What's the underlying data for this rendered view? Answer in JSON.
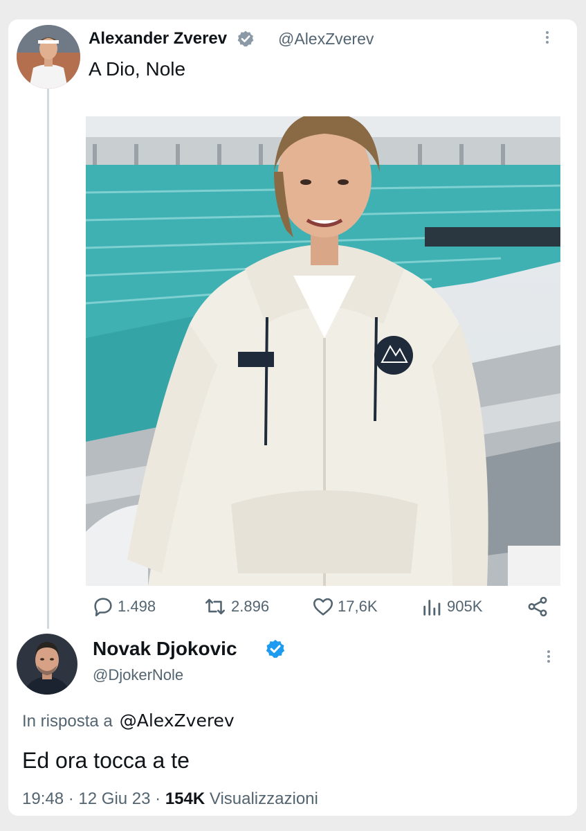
{
  "original_tweet": {
    "author_name": "Alexander Zverev",
    "author_handle": "@AlexZverev",
    "text": "A Dio, Nole",
    "stats": {
      "replies": "1.498",
      "retweets": "2.896",
      "likes": "17,6K",
      "views": "905K"
    }
  },
  "reply_tweet": {
    "author_name": "Novak Djokovic",
    "author_handle": "@DjokerNole",
    "reply_to_label": "In risposta a",
    "reply_to_handle": "@AlexZverev",
    "text": "Ed ora tocca a te",
    "time": "19:48",
    "date": "12 Giu 23",
    "views_count": "154K",
    "views_label": "Visualizzazioni",
    "separator": "·"
  },
  "icons": {
    "verified": "verified-badge-icon",
    "more": "more-options-icon",
    "reply": "reply-icon",
    "retweet": "retweet-icon",
    "like": "heart-icon",
    "views": "views-chart-icon",
    "share": "share-icon"
  },
  "colors": {
    "verified_blue": "#1d9bf0",
    "verified_gray": "#8b98a5",
    "text_secondary": "#536471"
  }
}
